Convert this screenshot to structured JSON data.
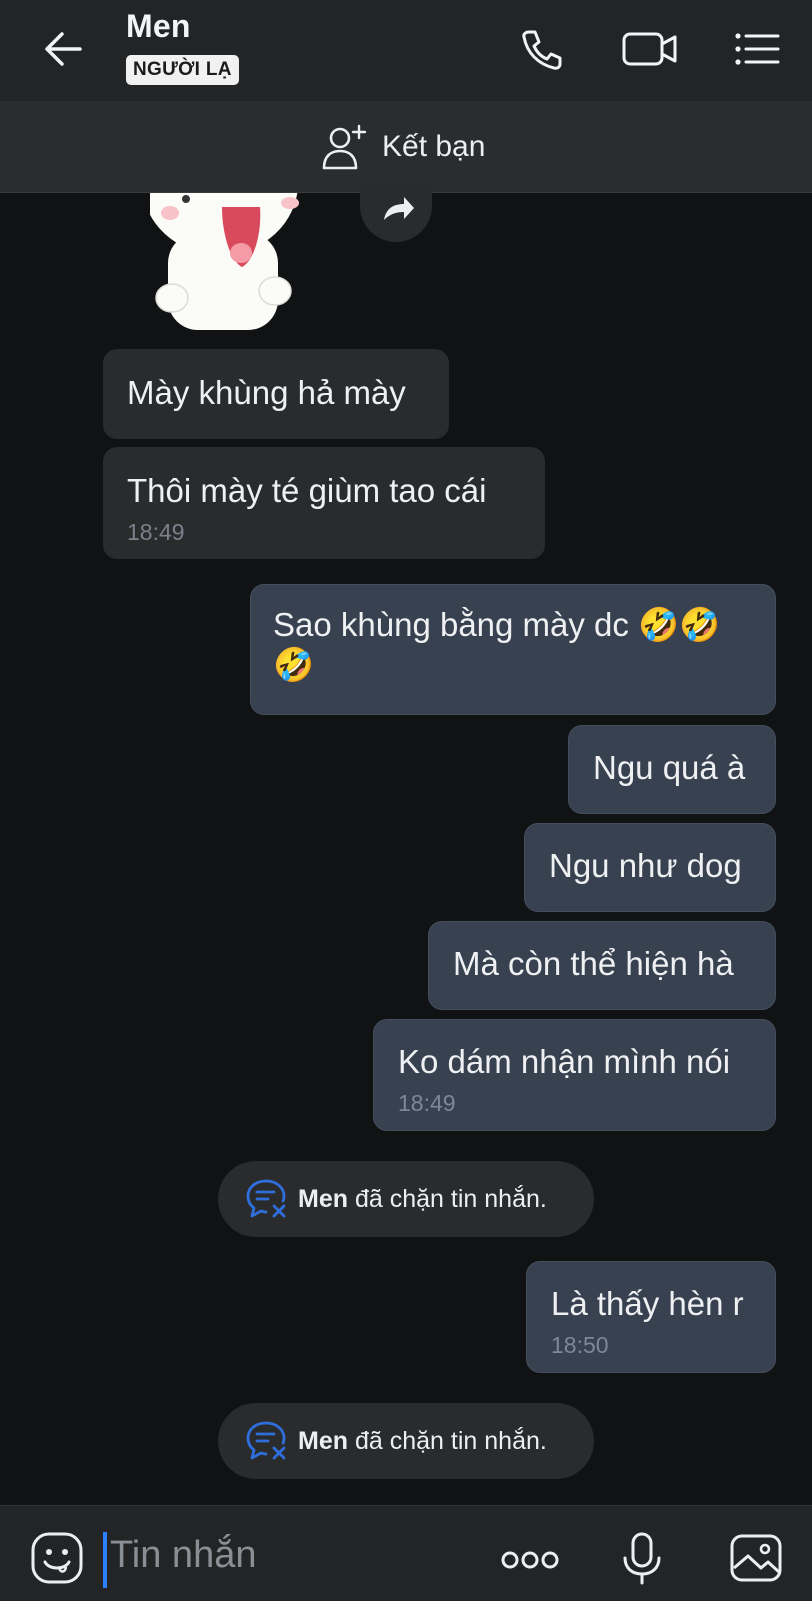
{
  "header": {
    "contact_name": "Men",
    "badge": "NGƯỜI LẠ",
    "icons": [
      "back-arrow-icon",
      "phone-icon",
      "video-call-icon",
      "menu-list-icon"
    ]
  },
  "friend_bar": {
    "label": "Kết bạn",
    "icon": "add-friend-icon"
  },
  "messages": [
    {
      "dir": "in",
      "text": "Mày khùng hả mày"
    },
    {
      "dir": "in",
      "text": "Thôi mày té giùm tao cái",
      "time": "18:49"
    },
    {
      "dir": "out",
      "text_line1": "Sao khùng bằng mày dc 🤣🤣",
      "text_line2": "🤣"
    },
    {
      "dir": "out",
      "text": "Ngu quá à"
    },
    {
      "dir": "out",
      "text": "Ngu như dog"
    },
    {
      "dir": "out",
      "text": "Mà còn thể hiện hà"
    },
    {
      "dir": "out",
      "text": "Ko dám nhận mình nói",
      "time": "18:49"
    },
    {
      "dir": "out",
      "text": "Là thấy hèn r",
      "time": "18:50"
    }
  ],
  "notices": [
    {
      "name": "Men",
      "text": "đã chặn tin nhắn."
    },
    {
      "name": "Men",
      "text": "đã chặn tin nhắn."
    }
  ],
  "composer": {
    "placeholder": "Tin nhắn",
    "icons": [
      "emoji-icon",
      "more-options-icon",
      "microphone-icon",
      "gallery-icon"
    ]
  },
  "colors": {
    "background": "#111213",
    "incoming_bubble": "#2a2b2d",
    "outgoing_bubble": "#384150",
    "caret": "#2f80ff",
    "notice_icon": "#2f6fdc"
  }
}
